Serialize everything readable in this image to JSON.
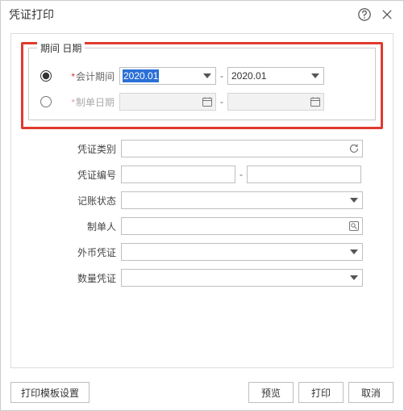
{
  "title": "凭证打印",
  "period_group": {
    "legend": "期间 日期",
    "by_period": {
      "checked": true,
      "label": "会计期间",
      "from": "2020.01",
      "to": "2020.01"
    },
    "by_date": {
      "checked": false,
      "label": "制单日期",
      "from": "",
      "to": ""
    }
  },
  "fields": {
    "voucher_type": {
      "label": "凭证类别",
      "value": ""
    },
    "voucher_no": {
      "label": "凭证编号",
      "from": "",
      "to": ""
    },
    "post_status": {
      "label": "记账状态",
      "value": ""
    },
    "maker": {
      "label": "制单人",
      "value": ""
    },
    "fx_voucher": {
      "label": "外币凭证",
      "value": ""
    },
    "qty_voucher": {
      "label": "数量凭证",
      "value": ""
    }
  },
  "footer": {
    "template_settings": "打印模板设置",
    "preview": "预览",
    "print": "打印",
    "cancel": "取消"
  },
  "range_sep": "-"
}
